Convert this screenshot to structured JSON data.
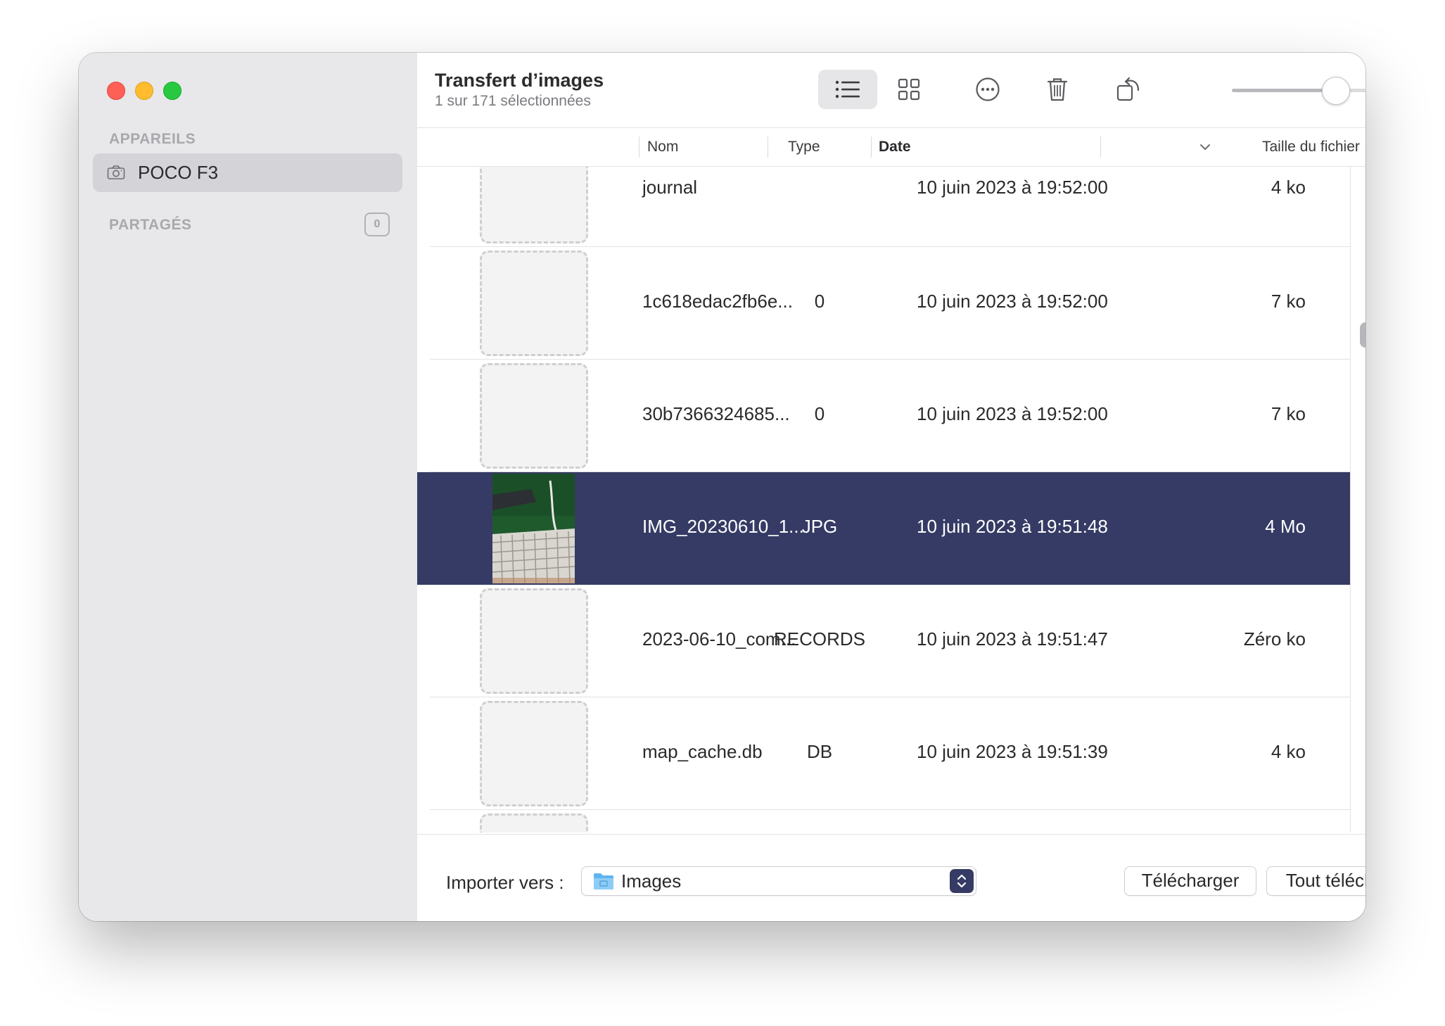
{
  "window": {
    "title": "Transfert d’images",
    "subtitle": "1 sur 171 sélectionnées"
  },
  "sidebar": {
    "devices_label": "APPAREILS",
    "devices": [
      {
        "label": "POCO F3",
        "icon": "camera-icon",
        "selected": true
      }
    ],
    "shared_label": "PARTAGÉS",
    "shared_count": "0"
  },
  "toolbar": {
    "buttons": [
      "list-view-icon",
      "grid-view-icon",
      "more-icon",
      "trash-icon",
      "rotate-icon"
    ],
    "active_view": "list",
    "zoom_level": 0.74
  },
  "table": {
    "columns": {
      "name": "Nom",
      "type": "Type",
      "date": "Date",
      "size": "Taille du fichier"
    },
    "sort_column": "Date",
    "sort_direction": "descending",
    "rows": [
      {
        "name": "journal",
        "type": "",
        "date": "10 juin 2023 à 19:52:00",
        "size": "4 ko",
        "selected": false,
        "thumbnail": "placeholder"
      },
      {
        "name": "1c618edac2fb6e...",
        "type": "0",
        "date": "10 juin 2023 à 19:52:00",
        "size": "7 ko",
        "selected": false,
        "thumbnail": "placeholder"
      },
      {
        "name": "30b7366324685...",
        "type": "0",
        "date": "10 juin 2023 à 19:52:00",
        "size": "7 ko",
        "selected": false,
        "thumbnail": "placeholder"
      },
      {
        "name": "IMG_20230610_1...",
        "type": "JPG",
        "date": "10 juin 2023 à 19:51:48",
        "size": "4 Mo",
        "selected": true,
        "thumbnail": "photo"
      },
      {
        "name": "2023-06-10_com...",
        "type": "RECORDS",
        "date": "10 juin 2023 à 19:51:47",
        "size": "Zéro ko",
        "selected": false,
        "thumbnail": "placeholder"
      },
      {
        "name": "map_cache.db",
        "type": "DB",
        "date": "10 juin 2023 à 19:51:39",
        "size": "4 ko",
        "selected": false,
        "thumbnail": "placeholder"
      }
    ]
  },
  "footer": {
    "import_label": "Importer vers :",
    "import_destination": "Images",
    "download_button": "Télécharger",
    "download_all_button": "Tout télécharger"
  },
  "colors": {
    "accent": "#353b64",
    "sidebar_bg": "#e8e7ea",
    "selection_sidebar": "#d4d3d7",
    "close": "#fe5f57",
    "minimize": "#febc2e",
    "zoom": "#28c840"
  }
}
